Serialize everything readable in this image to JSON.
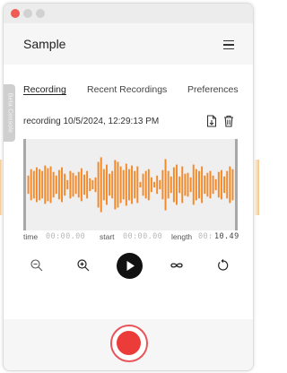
{
  "window": {
    "title_bar_buttons": [
      "close",
      "minimize",
      "maximize"
    ]
  },
  "header": {
    "title": "Sample",
    "menu_icon": "hamburger-menu-icon"
  },
  "beta": {
    "label": "Beta Console"
  },
  "tabs": [
    {
      "label": "Recording",
      "active": true
    },
    {
      "label": "Recent Recordings",
      "active": false
    },
    {
      "label": "Preferences",
      "active": false
    }
  ],
  "recording": {
    "name": "recording 10/5/2024, 12:29:13 PM",
    "save_icon": "save-file-icon",
    "delete_icon": "trash-icon"
  },
  "waveform": {
    "color": "#f28a2b",
    "amplitudes": [
      0.2,
      0.34,
      0.3,
      0.38,
      0.34,
      0.3,
      0.42,
      0.36,
      0.4,
      0.28,
      0.2,
      0.32,
      0.38,
      0.24,
      0.1,
      0.3,
      0.26,
      0.2,
      0.28,
      0.36,
      0.22,
      0.3,
      0.14,
      0.1,
      0.16,
      0.5,
      0.6,
      0.34,
      0.44,
      0.24,
      0.3,
      0.54,
      0.5,
      0.4,
      0.32,
      0.46,
      0.34,
      0.42,
      0.3,
      0.4,
      0.06,
      0.24,
      0.3,
      0.34,
      0.16,
      0.06,
      0.2,
      0.1,
      0.32,
      0.56,
      0.3,
      0.18,
      0.38,
      0.44,
      0.18,
      0.4,
      0.24,
      0.26,
      0.16,
      0.44,
      0.34,
      0.3,
      0.4,
      0.2,
      0.26,
      0.3,
      0.2,
      0.12,
      0.28,
      0.32,
      0.18,
      0.3,
      0.4,
      0.34
    ]
  },
  "times": {
    "time_label": "time",
    "time_value": "00:00.00",
    "start_label": "start",
    "start_value": "00:00.00",
    "length_label": "length",
    "length_prefix": "00:",
    "length_value": "10.49"
  },
  "controls": [
    "zoom-out-icon",
    "zoom-in-icon",
    "play-icon",
    "loop-icon",
    "reset-icon"
  ],
  "colors": {
    "accent": "#f28a2b",
    "record": "#ec3c3a",
    "record_ring": "#e8545a"
  }
}
